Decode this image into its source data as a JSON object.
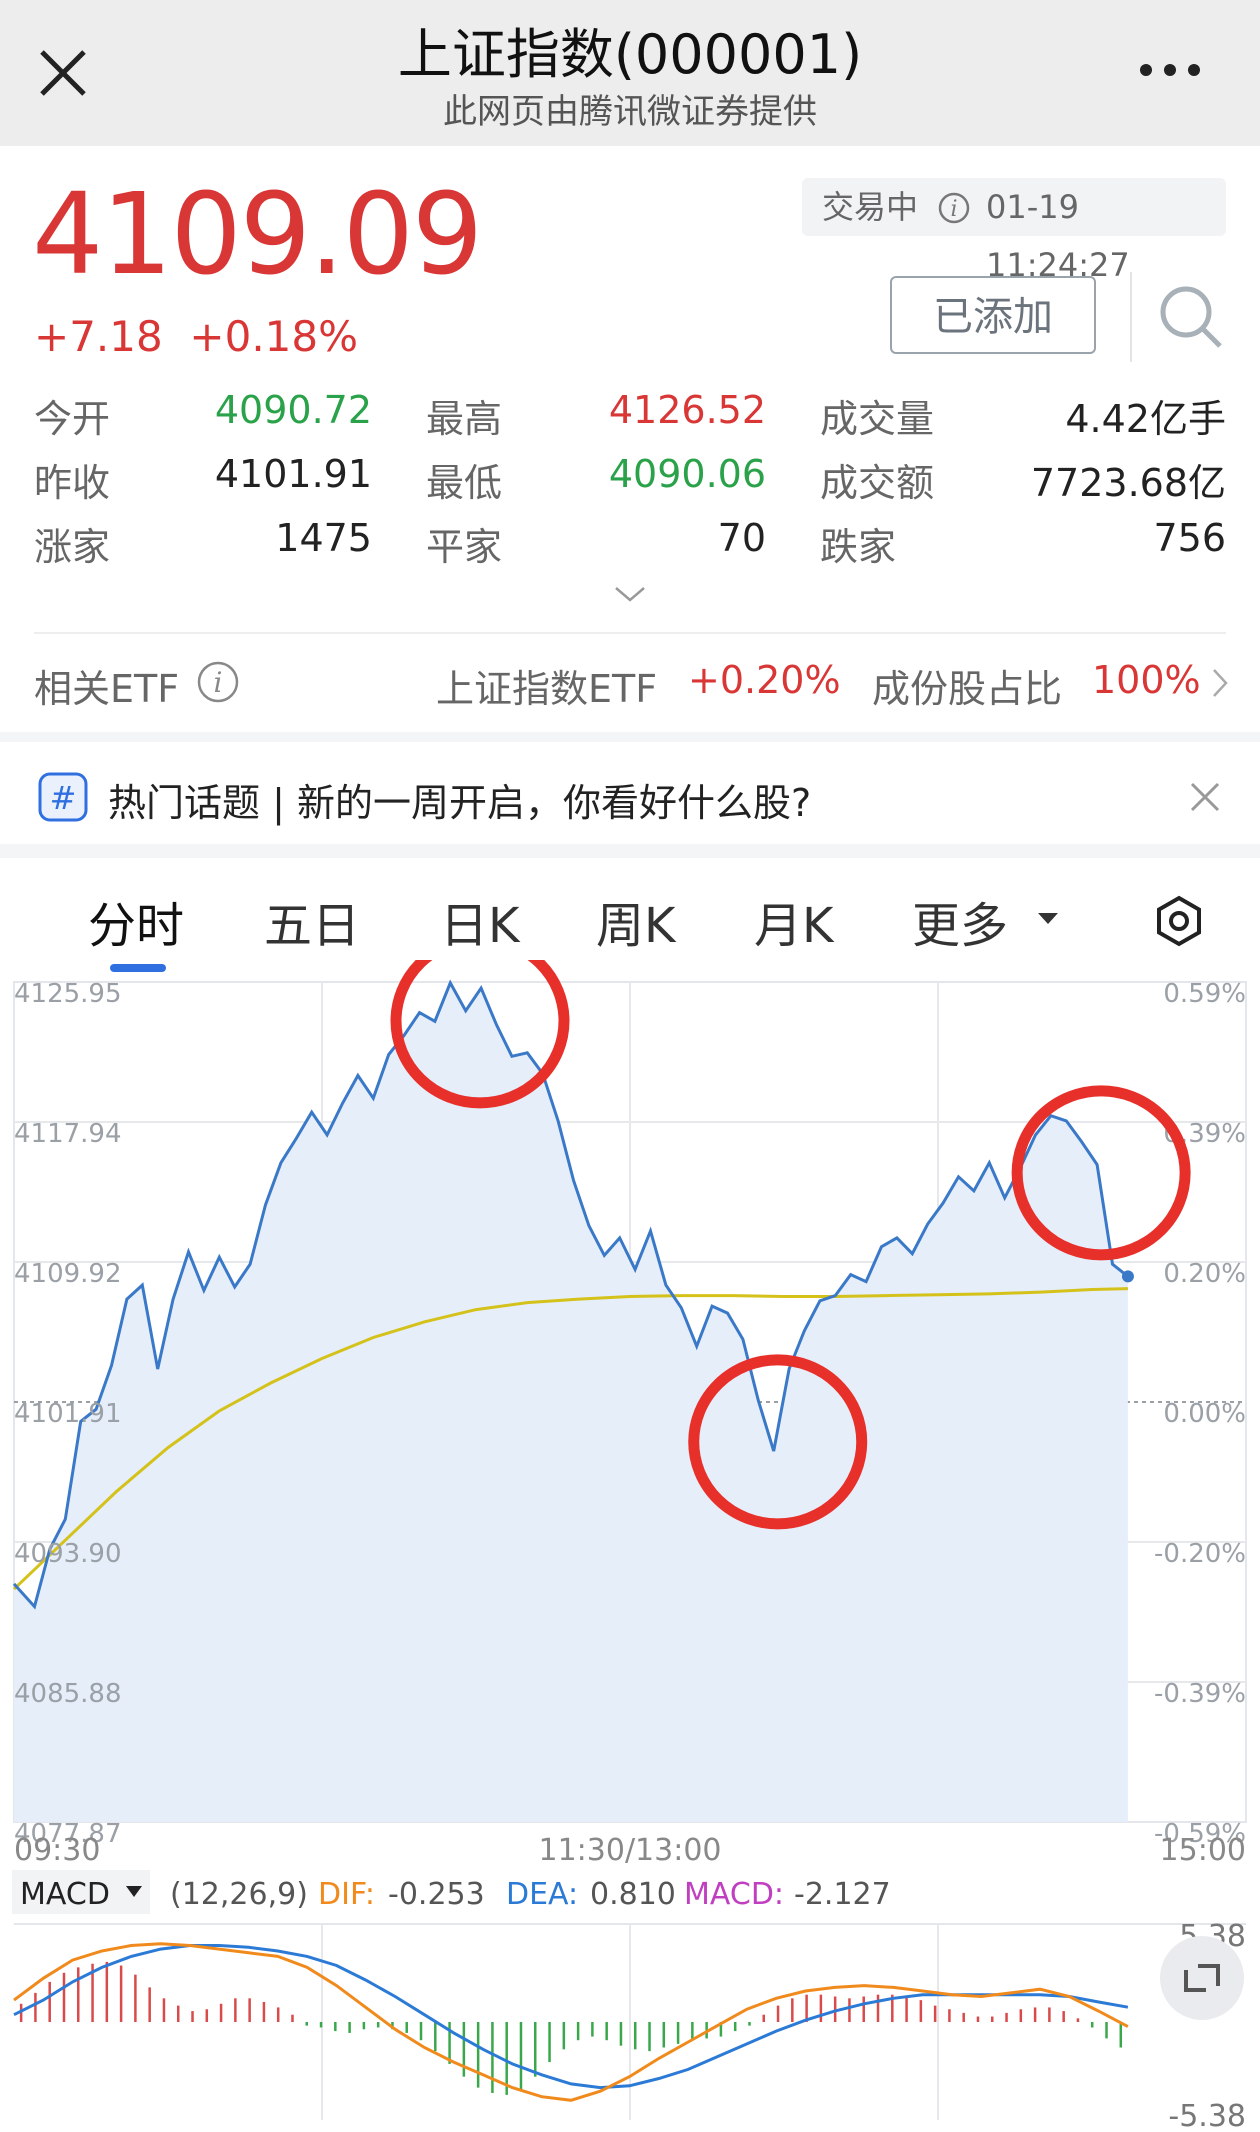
{
  "header": {
    "title": "上证指数(000001)",
    "subtitle": "此网页由腾讯微证券提供",
    "close_icon": "close-icon",
    "more_icon": "more-dots-icon"
  },
  "quote": {
    "price": "4109.09",
    "change": "+7.18",
    "change_pct": "+0.18%",
    "status": "交易中",
    "datetime": "01-19 11:24:27",
    "add_button": "已添加",
    "colors": {
      "up": "#d93636",
      "down": "#2aa24a"
    }
  },
  "stats": [
    {
      "label": "今开",
      "value": "4090.72",
      "tone": "green"
    },
    {
      "label": "最高",
      "value": "4126.52",
      "tone": "red"
    },
    {
      "label": "成交量",
      "value": "4.42亿手",
      "tone": "dark"
    },
    {
      "label": "昨收",
      "value": "4101.91",
      "tone": "dark"
    },
    {
      "label": "最低",
      "value": "4090.06",
      "tone": "green"
    },
    {
      "label": "成交额",
      "value": "7723.68亿",
      "tone": "dark"
    },
    {
      "label": "涨家",
      "value": "1475",
      "tone": "dark"
    },
    {
      "label": "平家",
      "value": "70",
      "tone": "dark"
    },
    {
      "label": "跌家",
      "value": "756",
      "tone": "dark"
    }
  ],
  "etf": {
    "label": "相关ETF",
    "name": "上证指数ETF",
    "change": "+0.20%",
    "ratio_label": "成份股占比",
    "ratio": "100%"
  },
  "banner": {
    "icon": "hashtag-icon",
    "text": "热门话题 | 新的一周开启，你看好什么股?"
  },
  "tabs": {
    "items": [
      "分时",
      "五日",
      "日K",
      "周K",
      "月K",
      "更多"
    ],
    "active": "分时"
  },
  "chart_data": [
    {
      "type": "line",
      "title": "",
      "y_left_ticks": [
        "4125.95",
        "4117.94",
        "4109.92",
        "4101.91",
        "4093.90",
        "4085.88",
        "4077.87"
      ],
      "y_right_ticks": [
        "0.59%",
        "0.39%",
        "0.20%",
        "0.00%",
        "-0.20%",
        "-0.39%",
        "-0.59%"
      ],
      "ylim": [
        4077.87,
        4125.95
      ],
      "x_ticks": [
        "09:30",
        "11:30/13:00",
        "15:00"
      ],
      "reference": 4101.91,
      "series": [
        {
          "color": "#3a78c8",
          "points": [
            [
              0,
              4091.5
            ],
            [
              4,
              4090.2
            ],
            [
              7,
              4093.5
            ],
            [
              10,
              4095.2
            ],
            [
              13,
              4100.8
            ],
            [
              16,
              4101.5
            ],
            [
              19,
              4104.0
            ],
            [
              22,
              4107.8
            ],
            [
              25,
              4108.6
            ],
            [
              28,
              4103.8
            ],
            [
              31,
              4107.8
            ],
            [
              34,
              4110.5
            ],
            [
              37,
              4108.3
            ],
            [
              40,
              4110.2
            ],
            [
              43,
              4108.5
            ],
            [
              46,
              4109.8
            ],
            [
              49,
              4113.2
            ],
            [
              52,
              4115.6
            ],
            [
              55,
              4117.0
            ],
            [
              58,
              4118.5
            ],
            [
              61,
              4117.2
            ],
            [
              64,
              4119.0
            ],
            [
              67,
              4120.6
            ],
            [
              70,
              4119.3
            ],
            [
              73,
              4121.8
            ],
            [
              76,
              4122.9
            ],
            [
              79,
              4124.2
            ],
            [
              82,
              4123.7
            ],
            [
              85,
              4125.9
            ],
            [
              88,
              4124.3
            ],
            [
              91,
              4125.6
            ],
            [
              94,
              4123.5
            ],
            [
              97,
              4121.7
            ],
            [
              100,
              4121.9
            ],
            [
              103,
              4120.7
            ],
            [
              106,
              4118.0
            ],
            [
              109,
              4114.6
            ],
            [
              112,
              4112.0
            ],
            [
              115,
              4110.3
            ],
            [
              118,
              4111.3
            ],
            [
              121,
              4109.5
            ],
            [
              124,
              4111.7
            ],
            [
              127,
              4108.6
            ],
            [
              130,
              4107.3
            ],
            [
              133,
              4105.1
            ],
            [
              136,
              4107.4
            ],
            [
              139,
              4107.0
            ],
            [
              142,
              4105.5
            ],
            [
              145,
              4102.0
            ],
            [
              148,
              4099.1
            ],
            [
              151,
              4103.8
            ],
            [
              154,
              4106.0
            ],
            [
              157,
              4107.7
            ],
            [
              160,
              4108.0
            ],
            [
              163,
              4109.2
            ],
            [
              166,
              4108.8
            ],
            [
              169,
              4110.8
            ],
            [
              172,
              4111.3
            ],
            [
              175,
              4110.4
            ],
            [
              178,
              4112.1
            ],
            [
              181,
              4113.3
            ],
            [
              184,
              4114.8
            ],
            [
              187,
              4114.0
            ],
            [
              190,
              4115.6
            ],
            [
              193,
              4113.6
            ],
            [
              196,
              4115.3
            ],
            [
              199,
              4117.2
            ],
            [
              202,
              4118.3
            ],
            [
              205,
              4118.0
            ],
            [
              208,
              4116.8
            ],
            [
              211,
              4115.5
            ],
            [
              214,
              4109.8
            ],
            [
              217,
              4109.1
            ]
          ]
        },
        {
          "color": "#d4c21a",
          "points": [
            [
              0,
              4091.2
            ],
            [
              10,
              4094.0
            ],
            [
              20,
              4096.8
            ],
            [
              30,
              4099.3
            ],
            [
              40,
              4101.4
            ],
            [
              50,
              4103.0
            ],
            [
              60,
              4104.4
            ],
            [
              70,
              4105.6
            ],
            [
              80,
              4106.5
            ],
            [
              90,
              4107.2
            ],
            [
              100,
              4107.6
            ],
            [
              110,
              4107.8
            ],
            [
              120,
              4107.95
            ],
            [
              130,
              4108.0
            ],
            [
              140,
              4108.0
            ],
            [
              150,
              4107.95
            ],
            [
              160,
              4107.95
            ],
            [
              170,
              4108.0
            ],
            [
              180,
              4108.05
            ],
            [
              190,
              4108.1
            ],
            [
              200,
              4108.2
            ],
            [
              210,
              4108.35
            ],
            [
              217,
              4108.4
            ]
          ]
        }
      ],
      "annotations": [
        "highlight circle at morning high",
        "highlight circle at midday low",
        "highlight circle at late-morning high"
      ]
    },
    {
      "type": "bar",
      "indicator": "MACD",
      "params": "(12,26,9)",
      "dif_label": "DIF:",
      "dif": "-0.253",
      "dea_label": "DEA:",
      "dea": "0.810",
      "macd_label": "MACD:",
      "macd": "-2.127",
      "ylim": [
        -5.38,
        5.38
      ],
      "y_ticks": [
        "5.38",
        "-5.38"
      ],
      "dif_color": "#f08a1c",
      "dea_color": "#2b7ad6",
      "macd_color": "#c03fc0",
      "bars": [
        1.0,
        1.6,
        2.2,
        2.7,
        3.0,
        3.2,
        3.3,
        3.1,
        2.6,
        1.9,
        1.3,
        0.9,
        0.6,
        0.7,
        1.0,
        1.3,
        1.3,
        1.1,
        0.8,
        0.4,
        -0.2,
        -0.3,
        -0.5,
        -0.6,
        -0.4,
        -0.3,
        -0.4,
        -0.6,
        -1.0,
        -1.6,
        -2.3,
        -3.0,
        -3.6,
        -3.9,
        -4.0,
        -3.7,
        -3.0,
        -2.2,
        -1.5,
        -1.0,
        -0.8,
        -1.0,
        -1.3,
        -1.5,
        -1.6,
        -1.4,
        -1.2,
        -1.0,
        -0.9,
        -0.8,
        -0.5,
        -0.2,
        0.4,
        0.9,
        1.3,
        1.5,
        1.5,
        1.4,
        1.3,
        1.4,
        1.5,
        1.5,
        1.4,
        1.2,
        0.9,
        0.7,
        0.5,
        0.3,
        0.3,
        0.5,
        0.7,
        0.8,
        0.8,
        0.6,
        0.2,
        -0.3,
        -0.9,
        -1.4
      ],
      "dif_points": [
        1.2,
        2.4,
        3.4,
        3.9,
        4.2,
        4.3,
        4.2,
        4.0,
        3.8,
        3.6,
        3.0,
        2.0,
        0.8,
        -0.4,
        -1.4,
        -2.2,
        -2.9,
        -3.6,
        -4.1,
        -4.3,
        -3.8,
        -3.0,
        -2.0,
        -1.1,
        -0.2,
        0.7,
        1.3,
        1.7,
        1.9,
        2.0,
        1.9,
        1.7,
        1.5,
        1.4,
        1.6,
        1.8,
        1.4,
        0.6,
        -0.25
      ],
      "dea_points": [
        0.4,
        1.2,
        2.2,
        3.0,
        3.6,
        4.0,
        4.2,
        4.2,
        4.1,
        3.9,
        3.6,
        3.1,
        2.3,
        1.4,
        0.4,
        -0.6,
        -1.5,
        -2.3,
        -2.9,
        -3.4,
        -3.6,
        -3.5,
        -3.1,
        -2.6,
        -1.9,
        -1.2,
        -0.5,
        0.1,
        0.6,
        1.0,
        1.3,
        1.5,
        1.5,
        1.5,
        1.5,
        1.5,
        1.4,
        1.1,
        0.81
      ]
    }
  ]
}
